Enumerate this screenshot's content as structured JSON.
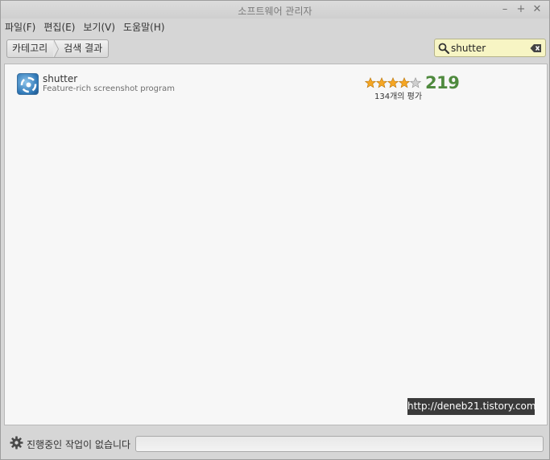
{
  "window": {
    "title": "소프트웨어 관리자",
    "controls": {
      "minimize": "–",
      "maximize": "+",
      "close": "✕"
    }
  },
  "menu": [
    "파일(F)",
    "편집(E)",
    "보기(V)",
    "도움말(H)"
  ],
  "breadcrumb": {
    "category": "카테고리",
    "current": "검색 결과"
  },
  "search": {
    "value": "shutter"
  },
  "results": [
    {
      "name": "shutter",
      "description": "Feature-rich screenshot program",
      "icon": "shutter-app-icon",
      "stars": 4,
      "max_stars": 5,
      "score": "219",
      "reviews": "134개의 평가"
    }
  ],
  "watermark": "http://deneb21.tistory.com",
  "status": {
    "text": "진행중인 작업이 없습니다"
  },
  "colors": {
    "search_bg": "#f7f5c4",
    "score": "#4f8a3e",
    "star_filled": "#f5a623",
    "star_empty": "#bdbdbd"
  }
}
